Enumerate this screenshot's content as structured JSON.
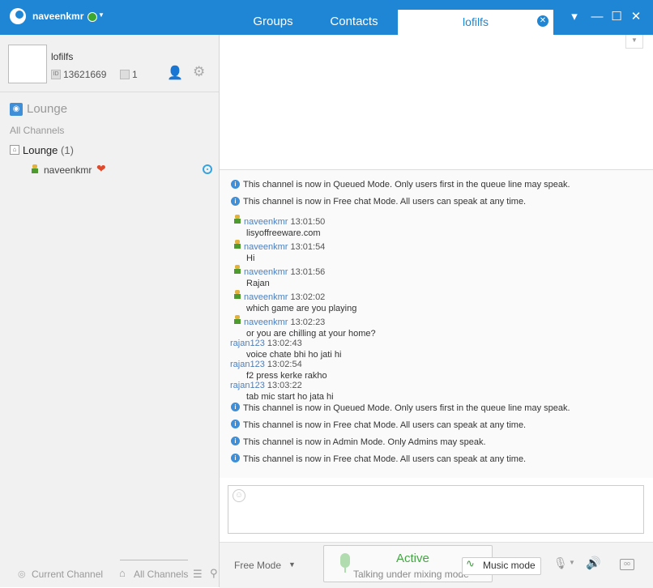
{
  "app": {
    "username": "naveenkmr"
  },
  "tabs": {
    "groups": "Groups",
    "contacts": "Contacts",
    "active": "lofilfs",
    "close": "✕"
  },
  "window": {
    "menu": "▾",
    "min": "—",
    "max": "☐",
    "close": "✕"
  },
  "channel": {
    "name": "lofilfs",
    "id": "13621669",
    "user_count": "1"
  },
  "sidebar": {
    "lounge_title": "Lounge",
    "all_channels": "All Channels",
    "lounge_row": "Lounge",
    "lounge_count": "(1)",
    "user": "naveenkmr"
  },
  "bottom_tabs": {
    "current_channel": "Current Channel",
    "all_channels": "All Channels"
  },
  "chat": {
    "sys1": "This channel is now in Queued Mode. Only users first in the queue line  may speak.",
    "sys2": "This channel is now in Free chat Mode. All users can speak at any time.",
    "messages": [
      {
        "sender": "naveenkmr",
        "time": "13:01:50",
        "text": "lisyoffreeware.com"
      },
      {
        "sender": "naveenkmr",
        "time": "13:01:54",
        "text": "Hi"
      },
      {
        "sender": "naveenkmr",
        "time": "13:01:56",
        "text": "Rajan"
      },
      {
        "sender": "naveenkmr",
        "time": "13:02:02",
        "text": "which game are you playing"
      },
      {
        "sender": "naveenkmr",
        "time": "13:02:23",
        "text": "or you are chilling at your home?"
      },
      {
        "sender": "rajan123",
        "time": "13:02:43",
        "text": "voice chate bhi ho jati hi"
      },
      {
        "sender": "rajan123",
        "time": "13:02:54",
        "text": "f2 press kerke rakho"
      },
      {
        "sender": "rajan123",
        "time": "13:03:22",
        "text": "tab mic start ho jata hi"
      }
    ],
    "sys3": "This channel is now in Queued Mode. Only users first in the queue line  may speak.",
    "sys4": "This channel is now in Free chat Mode. All users can speak at any time.",
    "sys5": "This channel is now in Admin Mode. Only Admins may speak.",
    "sys6": "This channel is now in Free chat Mode. All users can speak at any time."
  },
  "bottombar": {
    "mode": "Free Mode",
    "status": "Active",
    "status_sub": "Talking under mixing mode",
    "music": "Music mode"
  },
  "colors": {
    "accent": "#1f86d6",
    "active_green": "#45a545",
    "link_blue": "#4a7fc1"
  }
}
